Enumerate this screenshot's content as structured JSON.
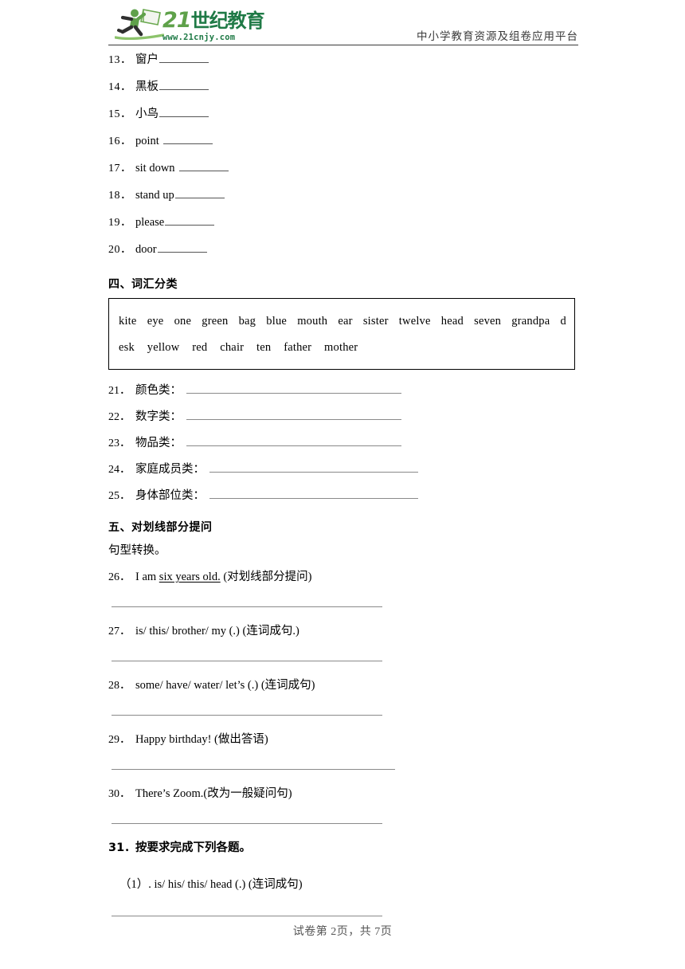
{
  "header": {
    "logo": {
      "icon": "running-person-with-flag-icon",
      "brand_21": "21",
      "brand_cn": "世纪教育",
      "url": "www.21cnjy.com",
      "color_light_green": "#5fa14a",
      "color_dark_green": "#1f7a46"
    },
    "tagline": "中小学教育资源及组卷应用平台"
  },
  "translation_items": [
    {
      "num": "13．",
      "text": "窗户",
      "gap": false
    },
    {
      "num": "14．",
      "text": "黑板",
      "gap": false
    },
    {
      "num": "15．",
      "text": "小鸟",
      "gap": false
    },
    {
      "num": "16．",
      "text": "point",
      "gap": true
    },
    {
      "num": "17．",
      "text": "sit down",
      "gap": true
    },
    {
      "num": "18．",
      "text": "stand up",
      "gap": false
    },
    {
      "num": "19．",
      "text": "please",
      "gap": false
    },
    {
      "num": "20．",
      "text": "door",
      "gap": false
    }
  ],
  "section_four": {
    "heading": "四、词汇分类",
    "word_bank_line1": [
      "kite",
      "eye",
      "one",
      "green",
      "bag",
      "blue",
      "mouth",
      "ear",
      "sister",
      "twelve",
      "head",
      "seven",
      "grandpa",
      "d"
    ],
    "word_bank_line2": [
      "esk",
      "yellow",
      "red",
      "chair",
      "ten",
      "father",
      "mother"
    ],
    "categories": [
      {
        "num": "21．",
        "label": "颜色类："
      },
      {
        "num": "22．",
        "label": "数字类："
      },
      {
        "num": "23．",
        "label": "物品类："
      },
      {
        "num": "24．",
        "label": "家庭成员类："
      },
      {
        "num": "25．",
        "label": "身体部位类："
      }
    ]
  },
  "section_five": {
    "heading": "五、对划线部分提问",
    "note": "句型转换。",
    "items": [
      {
        "num": "26．",
        "pre": "I am ",
        "underlined": "six years old.",
        "post": " (对划线部分提问)"
      },
      {
        "num": "27．",
        "pre": "is/ this/ brother/ my (.) (连词成句.)",
        "underlined": "",
        "post": ""
      },
      {
        "num": "28．",
        "pre": "some/ have/ water/ let’s (.) (连词成句)",
        "underlined": "",
        "post": ""
      },
      {
        "num": "29．",
        "pre": "Happy birthday! (做出答语)",
        "underlined": "",
        "post": ""
      },
      {
        "num": "30．",
        "pre": "There’s Zoom.(改为一般疑问句)",
        "underlined": "",
        "post": ""
      }
    ]
  },
  "question_31": {
    "num": "31．",
    "title": "按要求完成下列各题。",
    "sub_item": "（1）. is/ his/ this/ head (.) (连词成句)"
  },
  "footer": {
    "text": "试卷第 2页，共 7页"
  }
}
